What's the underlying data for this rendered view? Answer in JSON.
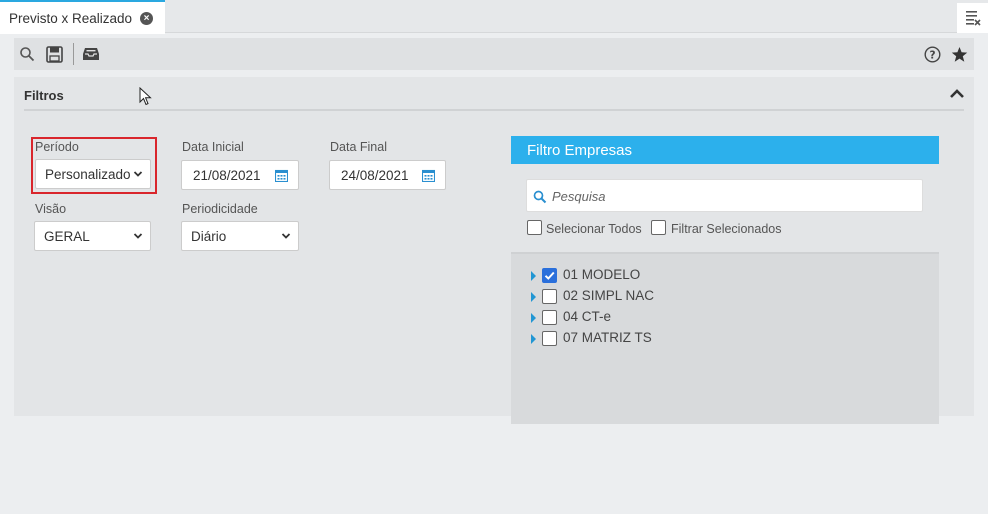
{
  "tab": {
    "title": "Previsto x Realizado"
  },
  "panel": {
    "title": "Filtros"
  },
  "fields": {
    "periodo": {
      "label": "Período",
      "value": "Personalizado"
    },
    "data_inicial": {
      "label": "Data Inicial",
      "value": "21/08/2021"
    },
    "data_final": {
      "label": "Data Final",
      "value": "24/08/2021"
    },
    "visao": {
      "label": "Visão",
      "value": "GERAL"
    },
    "periodicidade": {
      "label": "Periodicidade",
      "value": "Diário"
    }
  },
  "filtro_empresas": {
    "title": "Filtro Empresas",
    "search_placeholder": "Pesquisa",
    "select_all_label": "Selecionar Todos",
    "filter_selected_label": "Filtrar Selecionados",
    "items": [
      {
        "label": "01 MODELO",
        "checked": true
      },
      {
        "label": "02 SIMPL NAC",
        "checked": false
      },
      {
        "label": "04 CT-e",
        "checked": false
      },
      {
        "label": "07 MATRIZ TS",
        "checked": false
      }
    ]
  },
  "colors": {
    "accent": "#2cb0ec",
    "highlight_border": "#d9262c",
    "checkbox_checked": "#2a6fdb"
  }
}
